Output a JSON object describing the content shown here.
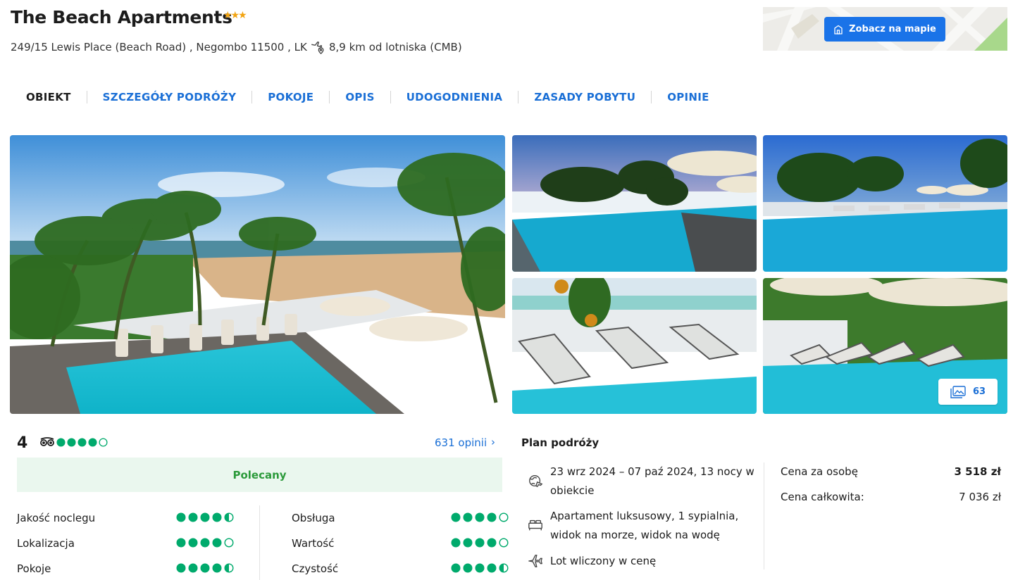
{
  "hotel": {
    "name": "The Beach Apartments",
    "stars": "★★★",
    "address": "249/15 Lewis Place (Beach Road) , Negombo 11500 , LK",
    "airport_distance": "8,9 km od lotniska (CMB)"
  },
  "map": {
    "button_label": "Zobacz na mapie"
  },
  "tabs": [
    {
      "label": "OBIEKT",
      "active": true
    },
    {
      "label": "SZCZEGÓŁY PODRÓŻY"
    },
    {
      "label": "POKOJE"
    },
    {
      "label": "OPIS"
    },
    {
      "label": "UDOGODNIENIA"
    },
    {
      "label": "ZASADY POBYTU"
    },
    {
      "label": "OPINIE"
    }
  ],
  "gallery": {
    "photo_count": "63"
  },
  "rating": {
    "score": "4",
    "tripadvisor_bubbles": 4,
    "reviews_link": "631 opinii",
    "badge": "Polecany",
    "subratings": [
      {
        "label": "Jakość noclegu",
        "value": 4.5
      },
      {
        "label": "Lokalizacja",
        "value": 4
      },
      {
        "label": "Pokoje",
        "value": 4.5
      },
      {
        "label": "Obsługa",
        "value": 4
      },
      {
        "label": "Wartość",
        "value": 4
      },
      {
        "label": "Czystość",
        "value": 4.5
      }
    ]
  },
  "plan": {
    "title": "Plan podróży",
    "dates": "23 wrz 2024 – 07 paź 2024, 13 nocy w obiekcie",
    "room": "Apartament luksusowy, 1 sypialnia, widok na morze, widok na wodę",
    "flight": "Lot wliczony w cenę"
  },
  "price": {
    "per_person_label": "Cena za osobę",
    "per_person_value": "3 518 zł",
    "total_label": "Cena całkowita:",
    "total_value": "7 036 zł"
  },
  "colors": {
    "link_blue": "#1a6fd6",
    "button_blue": "#1a73e8",
    "tripadvisor_green": "#00aa6c",
    "star_orange": "#f2a30f",
    "recommended_green": "#2b9a3a"
  }
}
